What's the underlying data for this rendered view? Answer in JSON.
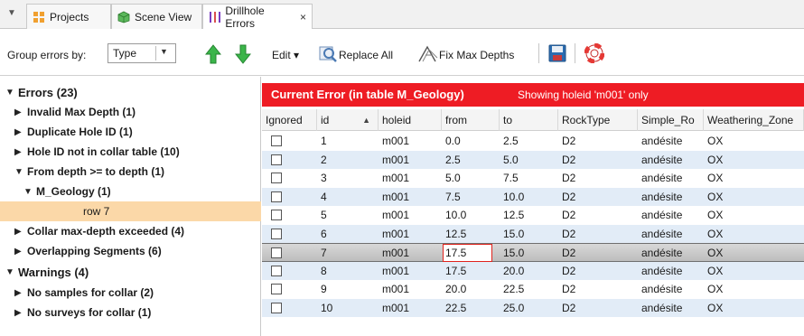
{
  "tabs": [
    {
      "label": "Projects",
      "icon": "projects-grid-icon"
    },
    {
      "label": "Scene View",
      "icon": "scene-cube-icon"
    },
    {
      "label": "Drillhole Errors",
      "icon": "drillhole-bars-icon",
      "active": true,
      "close": "×"
    }
  ],
  "toolbar": {
    "group_label": "Group errors by:",
    "group_value": "Type",
    "edit_label": "Edit ▾",
    "replace_all_label": "Replace All",
    "fix_max_depths_label": "Fix Max Depths"
  },
  "tree": {
    "errors_label": "Errors (23)",
    "items": [
      "Invalid Max Depth (1)",
      "Duplicate Hole ID (1)",
      "Hole ID not in collar table (10)",
      "From depth >= to depth (1)",
      "M_Geology (1)",
      "row 7",
      "Collar max-depth exceeded (4)",
      "Overlapping Segments (6)"
    ],
    "warnings_label": "Warnings (4)",
    "warning_items": [
      "No samples for collar (2)",
      "No surveys for collar (1)"
    ]
  },
  "error_header": {
    "title": "Current Error (in table M_Geology)",
    "subtitle": "Showing holeid 'm001' only"
  },
  "table": {
    "columns": [
      "Ignored",
      "id",
      "holeid",
      "from",
      "to",
      "RockType",
      "Simple_Ro",
      "Weathering_Zone"
    ],
    "rows": [
      [
        "1",
        "m001",
        "0.0",
        "2.5",
        "D2",
        "andésite",
        "OX"
      ],
      [
        "2",
        "m001",
        "2.5",
        "5.0",
        "D2",
        "andésite",
        "OX"
      ],
      [
        "3",
        "m001",
        "5.0",
        "7.5",
        "D2",
        "andésite",
        "OX"
      ],
      [
        "4",
        "m001",
        "7.5",
        "10.0",
        "D2",
        "andésite",
        "OX"
      ],
      [
        "5",
        "m001",
        "10.0",
        "12.5",
        "D2",
        "andésite",
        "OX"
      ],
      [
        "6",
        "m001",
        "12.5",
        "15.0",
        "D2",
        "andésite",
        "OX"
      ],
      [
        "7",
        "m001",
        "17.5",
        "15.0",
        "D2",
        "andésite",
        "OX"
      ],
      [
        "8",
        "m001",
        "17.5",
        "20.0",
        "D2",
        "andésite",
        "OX"
      ],
      [
        "9",
        "m001",
        "20.0",
        "22.5",
        "D2",
        "andésite",
        "OX"
      ],
      [
        "10",
        "m001",
        "22.5",
        "25.0",
        "D2",
        "andésite",
        "OX"
      ]
    ]
  },
  "colors": {
    "error_header": "#ee1c24",
    "selected_tree_row": "#fbd8a8",
    "alt_row": "#e2ecf7",
    "arrow_green": "#3bb54a"
  }
}
